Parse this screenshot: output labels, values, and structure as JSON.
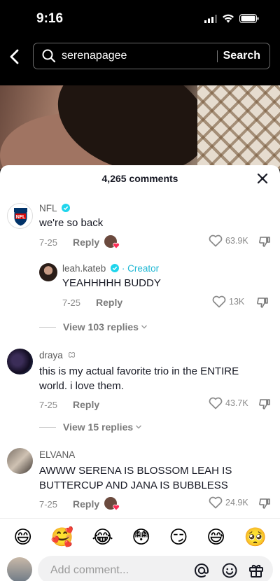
{
  "status": {
    "time": "9:16"
  },
  "search": {
    "query": "serenapagee",
    "button_label": "Search"
  },
  "comments_header": {
    "count_label": "4,265 comments"
  },
  "comments": [
    {
      "username": "NFL",
      "verified": true,
      "text": "we're so back",
      "date": "7-25",
      "reply_label": "Reply",
      "likes": "63.9K"
    },
    {
      "username": "leah.kateb",
      "verified": true,
      "role": "· Creator",
      "text": "YEAHHHHH BUDDY",
      "date": "7-25",
      "reply_label": "Reply",
      "likes": "13K"
    },
    {
      "view_replies": "View 103 replies"
    },
    {
      "username": "draya",
      "text": "this is my actual favorite trio in the ENTIRE world. i love them.",
      "date": "7-25",
      "reply_label": "Reply",
      "likes": "43.7K"
    },
    {
      "view_replies": "View 15 replies"
    },
    {
      "username": "ELVANA",
      "text": "AWWW SERENA IS BLOSSOM LEAH IS BUTTERCUP AND JANA IS BUBBLESS",
      "date": "7-25",
      "reply_label": "Reply",
      "likes": "24.9K"
    }
  ],
  "nfl_logo_text": "NFL",
  "emoji_bar": [
    "😄",
    "🥰",
    "😂",
    "😳",
    "😏",
    "😅",
    "🥺"
  ],
  "input": {
    "placeholder": "Add comment..."
  },
  "colors": {
    "verified": "#20d5ec",
    "creator": "#20b8d4",
    "heart_badge": "#fe2c55"
  }
}
